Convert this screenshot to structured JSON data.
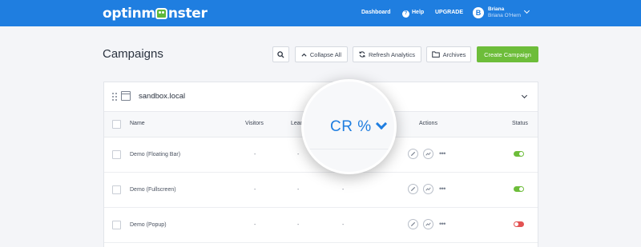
{
  "header": {
    "logo_text_1": "optinm",
    "logo_text_2": "nster",
    "nav": {
      "dashboard": "Dashboard",
      "help": "Help",
      "upgrade": "UPGRADE"
    },
    "user": {
      "initial": "B",
      "name": "Briana",
      "full_name": "Briana O'Hern"
    },
    "bg_color": "#1f7ee0"
  },
  "toolbar": {
    "title": "Campaigns",
    "collapse_label": "Collapse All",
    "refresh_label": "Refresh Analytics",
    "archives_label": "Archives",
    "create_label": "Create Campaign",
    "create_color": "#6dbd3a"
  },
  "site": {
    "name": "sandbox.local"
  },
  "table": {
    "columns": {
      "name": "Name",
      "visitors": "Visitors",
      "leads": "Leads",
      "actions": "Actions",
      "status": "Status"
    },
    "rows": [
      {
        "name": "Demo (Floating Bar)",
        "visitors": "-",
        "leads": "-",
        "cr": "-",
        "status": "on"
      },
      {
        "name": "Demo (Fullscreen)",
        "visitors": "-",
        "leads": "-",
        "cr": "-",
        "status": "on"
      },
      {
        "name": "Demo (Popup)",
        "visitors": "-",
        "leads": "-",
        "cr": "-",
        "status": "off"
      }
    ],
    "more_glyph": "•••"
  },
  "magnifier": {
    "label": "CR %"
  },
  "status_colors": {
    "on": "#6dbd3a",
    "off": "#e35353"
  }
}
